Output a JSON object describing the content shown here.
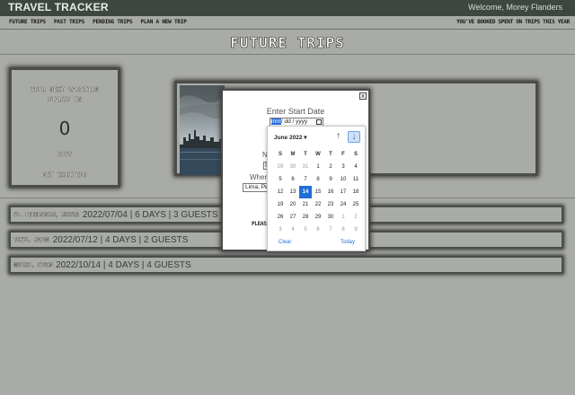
{
  "app": {
    "brand": "TRAVEL TRACKER",
    "welcome": "Welcome, Morey Flanders"
  },
  "nav": {
    "links": [
      "FUTURE TRIPS",
      "PAST TRIPS",
      "PENDING TRIPS",
      "PLAN A NEW TRIP"
    ],
    "spent": "YOU'VE BOOKED SPENT ON TRIPS THIS YEAR"
  },
  "page": {
    "title": "FUTURE TRIPS"
  },
  "countdown": {
    "label_line1": "YOUR NEXT VACATION",
    "label_line2": "STARTS IN",
    "number": "0",
    "unit": "DAYS",
    "status": "GET EXCITED!"
  },
  "trips": [
    {
      "destination": "ST. PETERSBURG, RUSSIA",
      "info": "2022/07/04 | 6 DAYS | 3 GUESTS"
    },
    {
      "destination": "TOKYO, JAPAN",
      "info": "2022/07/12 | 4 DAYS | 2 GUESTS"
    },
    {
      "destination": "MADRID, SPAIN",
      "info": "2022/10/14 | 4 DAYS | 4 GUESTS"
    }
  ],
  "modal": {
    "close": "x",
    "start_label": "Enter Start Date",
    "date_mm": "mm",
    "date_rest": "/ dd / yyyy",
    "duration_label": "No",
    "duration_value": "E",
    "where_label": "Wher",
    "where_value": "Lima, Pe",
    "submit": "PLEASE"
  },
  "calendar": {
    "month": "June 2022",
    "weekdays": [
      "S",
      "M",
      "T",
      "W",
      "T",
      "F",
      "S"
    ],
    "weeks": [
      [
        "29",
        "30",
        "31",
        "1",
        "2",
        "3",
        "4"
      ],
      [
        "5",
        "6",
        "7",
        "8",
        "9",
        "10",
        "11"
      ],
      [
        "12",
        "13",
        "14",
        "15",
        "16",
        "17",
        "18"
      ],
      [
        "19",
        "20",
        "21",
        "22",
        "23",
        "24",
        "25"
      ],
      [
        "26",
        "27",
        "28",
        "29",
        "30",
        "1",
        "2"
      ],
      [
        "3",
        "4",
        "5",
        "6",
        "7",
        "8",
        "9"
      ]
    ],
    "today_day": "14",
    "clear": "Clear",
    "today": "Today"
  }
}
